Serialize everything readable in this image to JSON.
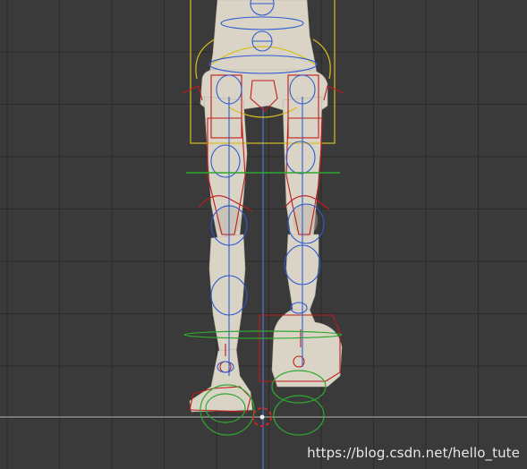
{
  "viewport": {
    "background_color": "#3a3a3a",
    "grid_color": "#2b2b2b",
    "floor_line_color": "#8d8d8d",
    "vertical_axis_color": "#4b78c8"
  },
  "model": {
    "skin_color": "#d9d4c6",
    "shadow_color": "#b9b2a3"
  },
  "rig_colors": {
    "selected_box": "#d8c020",
    "red_controls": "#c21a1a",
    "blue_controls": "#2f5bd3",
    "green_controls": "#2fa82f",
    "cursor_ring": "#f0f0f0",
    "cursor_accent": "#d42424"
  },
  "watermark": {
    "text": "https://blog.csdn.net/hello_tute"
  }
}
